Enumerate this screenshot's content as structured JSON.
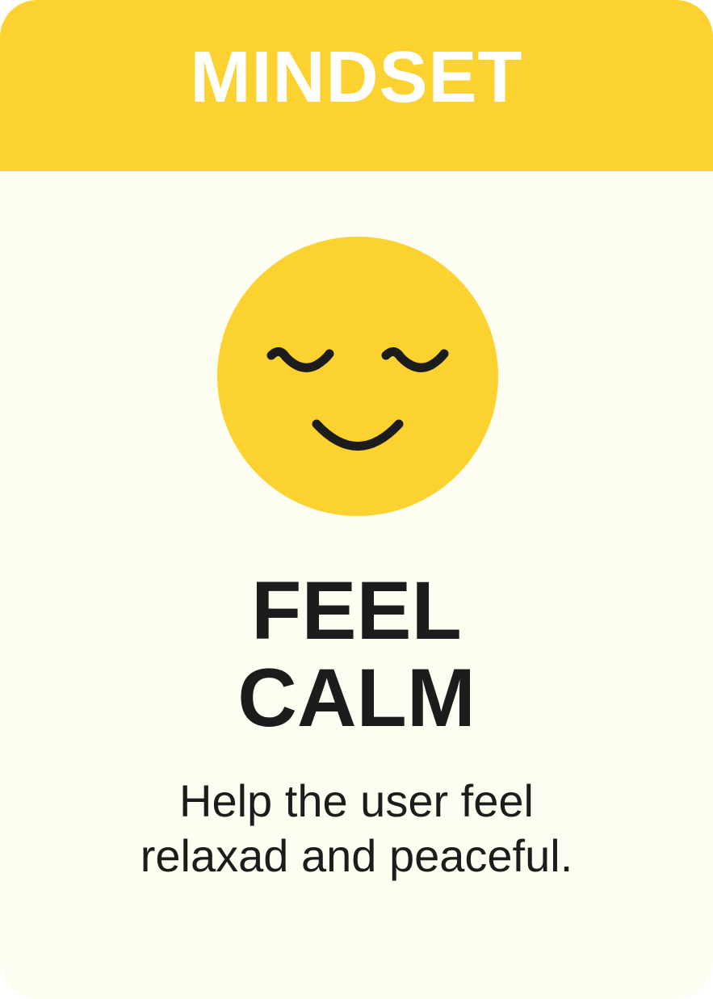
{
  "card": {
    "category": "MINDSET",
    "title_line1": "FEEL",
    "title_line2": "CALM",
    "description_line1": "Help the user feel",
    "description_line2": "relaxad and peaceful.",
    "icon": "calm-smiley-face-icon"
  },
  "colors": {
    "accent": "#FBD22F",
    "background": "#FEFDF2",
    "text": "#1C1C1C",
    "header_text": "#FFFFFF"
  }
}
